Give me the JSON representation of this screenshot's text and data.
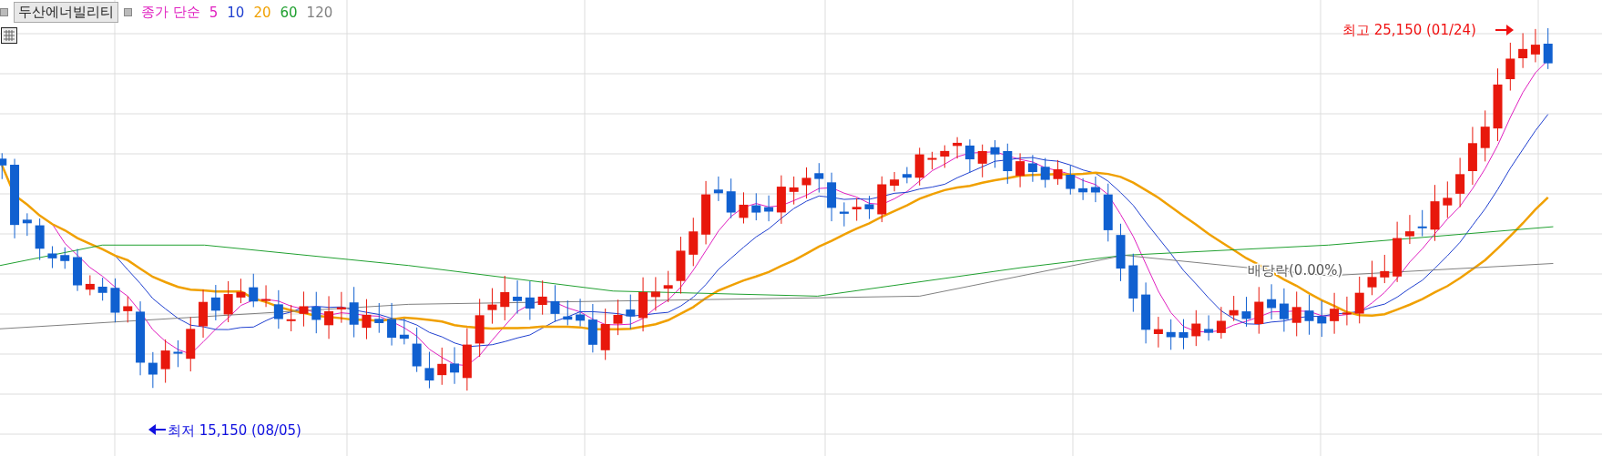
{
  "stock_button": "두산에너빌리티",
  "legend_title": "종가 단순",
  "legend_items": [
    {
      "label": "5",
      "color": "#e020c0"
    },
    {
      "label": "10",
      "color": "#2040d0"
    },
    {
      "label": "20",
      "color": "#f0a000"
    },
    {
      "label": "60",
      "color": "#20a030"
    },
    {
      "label": "120",
      "color": "#808080"
    }
  ],
  "annotations": {
    "high": "최고 25,150 (01/24)",
    "low": "최저 15,150 (08/05)",
    "dividend": "배당락(0.00%)"
  }
}
